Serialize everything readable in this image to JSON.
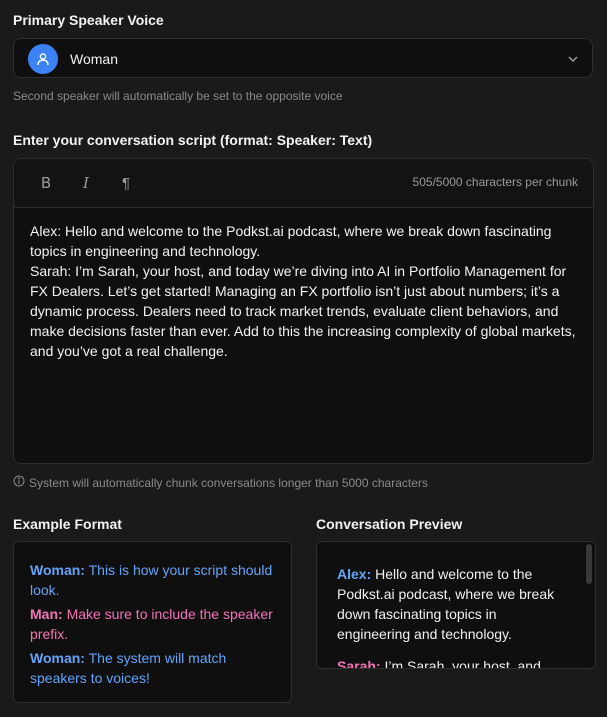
{
  "voice": {
    "label": "Primary Speaker Voice",
    "value": "Woman",
    "hint": "Second speaker will automatically be set to the opposite voice"
  },
  "script": {
    "label": "Enter your conversation script (format: Speaker: Text)",
    "char_count": "505/5000 characters per chunk",
    "toolbar": {
      "bold": "B",
      "italic": "I",
      "paragraph": "¶"
    },
    "lines": [
      "Alex: Hello and welcome to the Podkst.ai podcast, where we break down fascinating topics in engineering and technology.",
      "Sarah: I’m Sarah, your host, and today we’re diving into AI in Portfolio Management for FX Dealers. Let’s get started! Managing an FX portfolio isn’t just about numbers; it’s a dynamic process. Dealers need to track market trends, evaluate client behaviors, and make decisions faster than ever. Add to this the increasing complexity of global markets, and you’ve got a real challenge."
    ],
    "chunk_note": "System will automatically chunk conversations longer than 5000 characters"
  },
  "example": {
    "label": "Example Format",
    "items": [
      {
        "speaker": "Woman:",
        "text": "This is how your script should look."
      },
      {
        "speaker": "Man:",
        "text": "Make sure to include the speaker prefix."
      },
      {
        "speaker": "Woman:",
        "text": "The system will match speakers to voices!"
      }
    ]
  },
  "preview": {
    "label": "Conversation Preview",
    "items": [
      {
        "speaker": "Alex:",
        "text": "Hello and welcome to the Podkst.ai podcast, where we break down fascinating topics in engineering and technology."
      },
      {
        "speaker": "Sarah:",
        "text": "I’m Sarah, your host, and"
      }
    ]
  },
  "colors": {
    "background": "#1b1a1a",
    "panel": "#0f0f0f",
    "accent_blue": "#60a5fa",
    "accent_pink": "#f472b6",
    "avatar": "#3b82f6"
  },
  "icons": [
    "user-icon",
    "chevron-down-icon",
    "bold-icon",
    "italic-icon",
    "pilcrow-icon",
    "info-icon"
  ]
}
